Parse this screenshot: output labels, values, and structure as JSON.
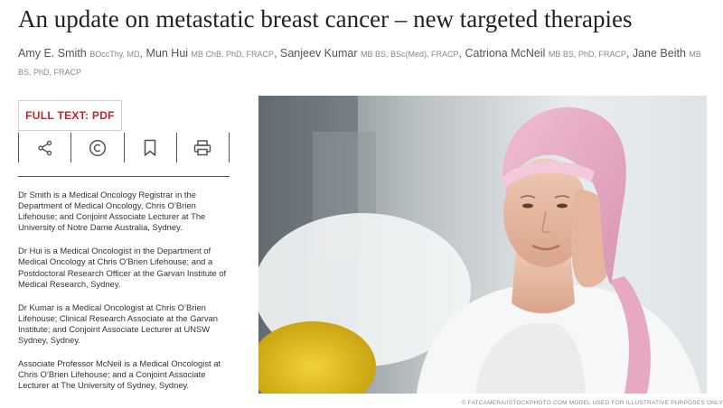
{
  "article": {
    "title": "An update on metastatic breast cancer – new targeted therapies"
  },
  "authors": [
    {
      "name": "Amy E. Smith",
      "credentials": "BOccThy, MD"
    },
    {
      "name": "Mun Hui",
      "credentials": "MB ChB, PhD, FRACP"
    },
    {
      "name": "Sanjeev Kumar",
      "credentials": "MB BS, BSc(Med), FRACP"
    },
    {
      "name": "Catriona McNeil",
      "credentials": "MB BS, PhD, FRACP"
    },
    {
      "name": "Jane Beith",
      "credentials": "MB BS, PhD, FRACP"
    }
  ],
  "actions": {
    "full_text_pdf": "FULL TEXT: PDF",
    "icons": [
      "share-icon",
      "copyright-icon",
      "bookmark-icon",
      "print-icon"
    ]
  },
  "affiliations": [
    "Dr Smith is a Medical Oncology Registrar in the Department of Medical Oncology, Chris O’Brien Lifehouse; and Conjoint Associate Lecturer at The University of Notre Dame Australia, Sydney.",
    "Dr Hui is a Medical Oncologist in the Department of Medical Oncology at Chris O’Brien Lifehouse; and a Postdoctoral Research Officer at the Garvan Institute of Medical Research, Sydney.",
    "Dr Kumar is a Medical Oncologist at Chris O’Brien Lifehouse; Clinical Research Associate at the Garvan Institute; and Conjoint Associate Lecturer at UNSW Sydney, Sydney.",
    "Associate Professor McNeil is a Medical Oncologist at Chris O’Brien Lifehouse; and a Conjoint Associate Lecturer at The University of Sydney, Sydney."
  ],
  "image": {
    "credit": "© FATCAMERA/ISTOCKPHOTO.COM MODEL USED FOR ILLUSTRATIVE PURPOSES ONLY"
  },
  "colors": {
    "accent": "#c0262d",
    "text": "#333333",
    "muted": "#666666",
    "headscarf": "#e6a9c2"
  }
}
